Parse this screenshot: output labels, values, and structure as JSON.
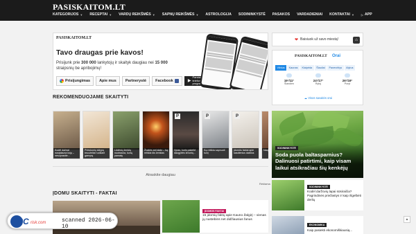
{
  "header": {
    "logo": "PASISKAITOM.LT",
    "nav": [
      {
        "label": "KATEGORIJOS",
        "dropdown": true
      },
      {
        "label": "RECEPTAI",
        "dropdown": true
      },
      {
        "label": "VARDŲ REIKŠMĖS",
        "dropdown": true
      },
      {
        "label": "SAPNŲ REIKŠMĖS",
        "dropdown": true
      },
      {
        "label": "ASTROLOGIJA",
        "dropdown": false
      },
      {
        "label": "SODININKYSTĖ",
        "dropdown": false
      },
      {
        "label": "PASAKOS",
        "dropdown": false
      },
      {
        "label": "VARDADIENIAI",
        "dropdown": false
      },
      {
        "label": "KONTAKTAI",
        "dropdown": true
      },
      {
        "label": "APP",
        "dropdown": false
      }
    ]
  },
  "promo": {
    "logo": "PASISKAITOM.LT",
    "title": "Tavo draugas prie kavos!",
    "text_pre": "Prisijunk prie ",
    "text_num1": "300 000",
    "text_mid": " lankytojų ir skaityk daugiau nei ",
    "text_num2": "15 000",
    "text_post": " straipsnių be apribojimų!",
    "buttons": {
      "login": "Prisijungimas",
      "about": "Apie mus",
      "partners": "Partnerystė",
      "facebook": "Facebook",
      "store": "Parsisiųsk ir telefonui: Android programėlę"
    }
  },
  "recommended": {
    "title": "REKOMENDUOJAME SKAITYTI",
    "cards": [
      {
        "caption": "Kodėl dažnai nusiplauna kojų – nesuprasite..."
      },
      {
        "caption": "Prieskonių sklypų bruoželiai ruošiant garnyrą"
      },
      {
        "caption": "Lūdėsių ženklų nuotrauka, kurią pamatę"
      },
      {
        "caption": "Žvakės ant stalo – ką reiškia šis ženklas"
      },
      {
        "caption": "Vyras, kuris pakeitė daugybės žmonių..."
      },
      {
        "caption": "Ką reiškia sapnuoti šunį"
      },
      {
        "caption": "Įdomūs faktai apie kasdienius daiktus"
      },
      {
        "caption": "Naujiena"
      }
    ]
  },
  "ad": {
    "text": "Atraskite daugiau",
    "label": "Reklama"
  },
  "facts": {
    "title": "ĮDOMU SKAITYTI - FAKTAI",
    "item_badge": "ĮDOMŪS FAKTAI",
    "item_title": "15 įdomių faktų apie Kauno Žalgirį – vienas jų nustebins net didžiausius fanus"
  },
  "sidebar": {
    "city_prompt": "Baisiuok už savo miestą!",
    "weather": {
      "logo": "PASISKAITOM.LT",
      "title": "Orai",
      "tabs": [
        "Vilnius",
        "Kaunas",
        "Klaipėda",
        "Šiauliai",
        "Panevėžys",
        "Alytus"
      ],
      "active_tab": "Vilnius",
      "days": [
        {
          "temp": "19°/11°",
          "day": "Šiandien"
        },
        {
          "temp": "24°/17°",
          "day": "Rytoj"
        },
        {
          "temp": "26°/19°",
          "day": "Poryt"
        }
      ],
      "all_link": "Visos savaitės orai"
    },
    "feature": {
      "badge": "SODININKYSTĖ",
      "title": "Soda puola baltasparnius? Dalinuosi patirtimi, kaip visam laikui atsikračiau šių kenkėjų"
    },
    "items": [
      {
        "badge": "SODININKYSTĖ",
        "title": "Kodėl daržovių lapai sūsiraičia? Pagrindinės priežastys ir kaip išgelbėti derlių"
      },
      {
        "badge": "EKONOMIKA",
        "title": "Kaip pasiekti ekonomiškiausią..."
      }
    ]
  },
  "watermark": {
    "brand_pc": "PC",
    "brand_risk": "risk.com",
    "scan": "scanned 2026-06-10"
  },
  "colors": {
    "topbar": "#1b1b1b",
    "accent_blue": "#1e88e5",
    "accent_pink": "#c2185b"
  }
}
